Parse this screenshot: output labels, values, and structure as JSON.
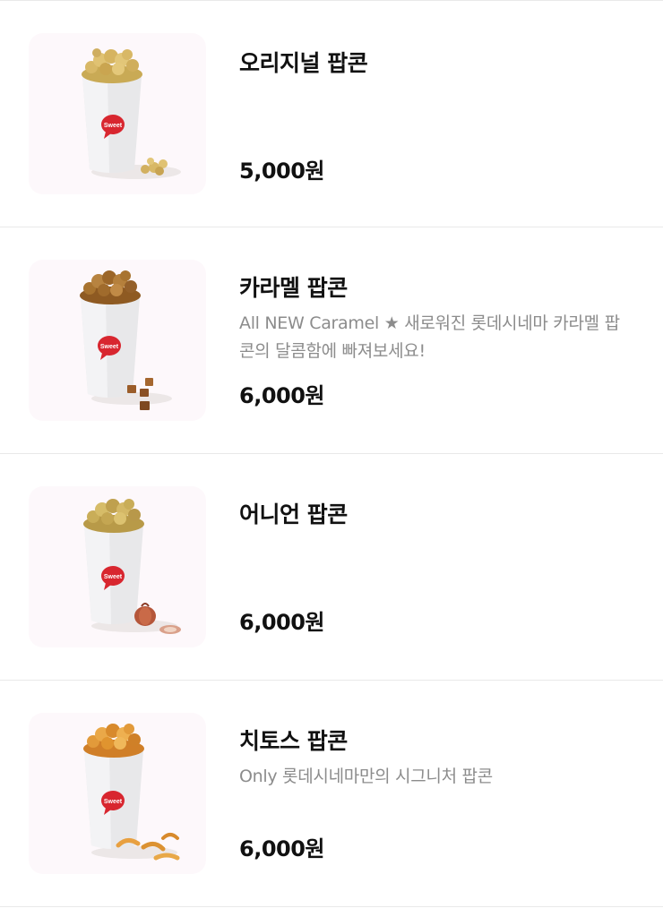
{
  "products": [
    {
      "name": "오리지널 팝콘",
      "description": "",
      "price": "5,000원",
      "image_icon": "original-popcorn-icon",
      "popcorn_color": "#d8b866"
    },
    {
      "name": "카라멜 팝콘",
      "description": "All NEW Caramel ★ 새로워진 롯데시네마 카라멜 팝콘의 달콤함에 빠져보세요!",
      "price": "6,000원",
      "image_icon": "caramel-popcorn-icon",
      "popcorn_color": "#a8732f"
    },
    {
      "name": "어니언 팝콘",
      "description": "",
      "price": "6,000원",
      "image_icon": "onion-popcorn-icon",
      "popcorn_color": "#c9ad58"
    },
    {
      "name": "치토스 팝콘",
      "description": "Only 롯데시네마만의 시그니처 팝콘",
      "price": "6,000원",
      "image_icon": "cheetos-popcorn-icon",
      "popcorn_color": "#e29a3a"
    }
  ],
  "cup_badge_text": "Sweet",
  "colors": {
    "badge_red": "#d8262f",
    "divider": "#e9e9e9",
    "description_gray": "#8c8c8c"
  }
}
